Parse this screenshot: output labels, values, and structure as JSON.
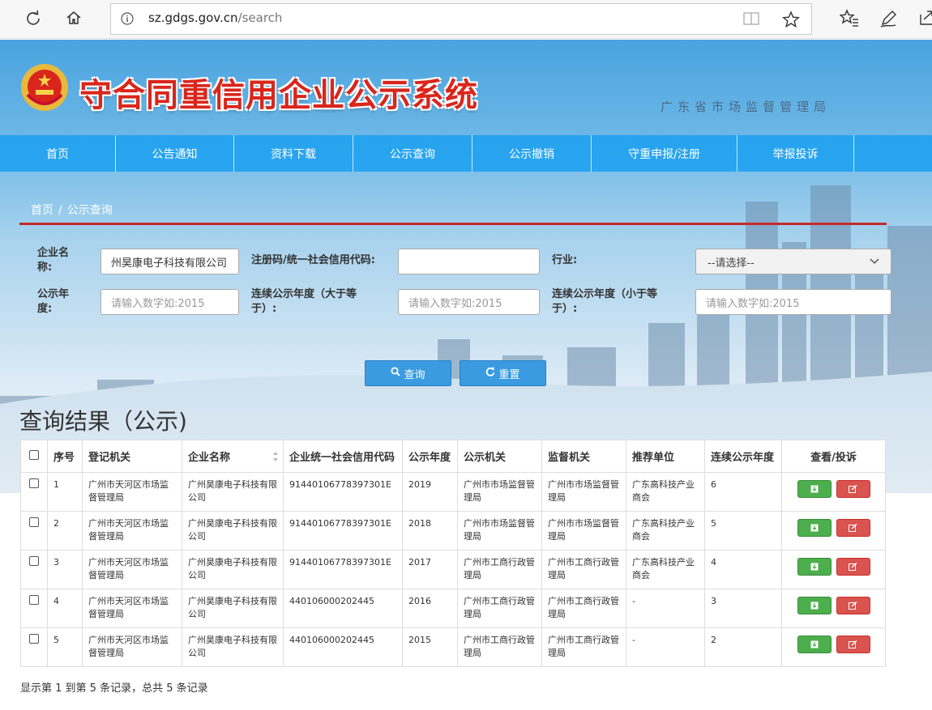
{
  "browser": {
    "url_host": "sz.gdgs.gov.cn",
    "url_path": "/search"
  },
  "header": {
    "site_title": "守合同重信用企业公示系统",
    "agency": "广东省市场监督管理局"
  },
  "nav": {
    "items": [
      "首页",
      "公告通知",
      "资料下载",
      "公示查询",
      "公示撤销",
      "守重申报/注册",
      "举报投诉"
    ]
  },
  "breadcrumb": {
    "home": "首页",
    "sep": "/",
    "current": "公示查询"
  },
  "form": {
    "company_name_label": "企业名称:",
    "company_name_value": "州昊康电子科技有限公司",
    "reg_code_label": "注册码/统一社会信用代码:",
    "reg_code_value": "",
    "industry_label": "行业:",
    "industry_value": "--请选择--",
    "year_label": "公示年度:",
    "year_placeholder": "请输入数字如:2015",
    "cont_gt_label": "连续公示年度（大于等于）:",
    "cont_gt_placeholder": "请输入数字如:2015",
    "cont_lt_label": "连续公示年度（小于等于）:",
    "cont_lt_placeholder": "请输入数字如:2015",
    "search_label": "查询",
    "reset_label": "重置"
  },
  "results": {
    "title": "查询结果（公示)",
    "columns": [
      "序号",
      "登记机关",
      "企业名称",
      "企业统一社会信用代码",
      "公示年度",
      "公示机关",
      "监督机关",
      "推荐单位",
      "连续公示年度",
      "查看/投诉"
    ],
    "rows": [
      {
        "no": "1",
        "reg": "广州市天河区市场监督管理局",
        "name": "广州昊康电子科技有限公司",
        "code": "91440106778397301E",
        "year": "2019",
        "pub": "广州市市场监督管理局",
        "sup": "广州市市场监督管理局",
        "rec": "广东高科技产业商会",
        "cont": "6"
      },
      {
        "no": "2",
        "reg": "广州市天河区市场监督管理局",
        "name": "广州昊康电子科技有限公司",
        "code": "91440106778397301E",
        "year": "2018",
        "pub": "广州市市场监督管理局",
        "sup": "广州市市场监督管理局",
        "rec": "广东高科技产业商会",
        "cont": "5"
      },
      {
        "no": "3",
        "reg": "广州市天河区市场监督管理局",
        "name": "广州昊康电子科技有限公司",
        "code": "91440106778397301E",
        "year": "2017",
        "pub": "广州市工商行政管理局",
        "sup": "广州市工商行政管理局",
        "rec": "广东高科技产业商会",
        "cont": "4"
      },
      {
        "no": "4",
        "reg": "广州市天河区市场监督管理局",
        "name": "广州昊康电子科技有限公司",
        "code": "440106000202445",
        "year": "2016",
        "pub": "广州市工商行政管理局",
        "sup": "广州市工商行政管理局",
        "rec": "-",
        "cont": "3"
      },
      {
        "no": "5",
        "reg": "广州市天河区市场监督管理局",
        "name": "广州昊康电子科技有限公司",
        "code": "440106000202445",
        "year": "2015",
        "pub": "广州市工商行政管理局",
        "sup": "广州市工商行政管理局",
        "rec": "-",
        "cont": "2"
      }
    ],
    "summary": "显示第 1 到第 5 条记录，总共 5 条记录"
  },
  "colors": {
    "nav_bg": "#1ea0f0",
    "title_red": "#d9261c",
    "divider_red": "#c62b2b",
    "view_green": "#4cae4c",
    "report_red": "#d9534f"
  }
}
